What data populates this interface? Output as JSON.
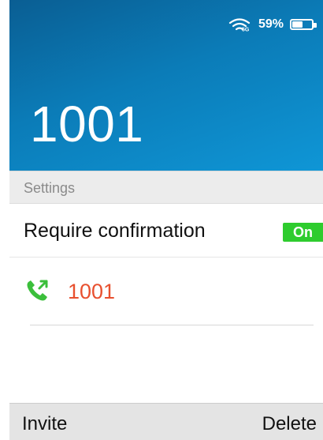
{
  "status_bar": {
    "network_label": "5G",
    "battery_text": "59%",
    "battery_level": 0.59
  },
  "header": {
    "title": "1001"
  },
  "section": {
    "label": "Settings"
  },
  "confirmation": {
    "label": "Require confirmation",
    "toggle_text": "On"
  },
  "number_item": {
    "icon": "outgoing-call-icon",
    "number": "1001"
  },
  "softkeys": {
    "left": "Invite",
    "right": "Delete"
  },
  "colors": {
    "header_start": "#0a5e93",
    "header_end": "#0f96d6",
    "toggle": "#2ecc2e",
    "number": "#e8502f",
    "call_icon": "#3bbf3b"
  }
}
